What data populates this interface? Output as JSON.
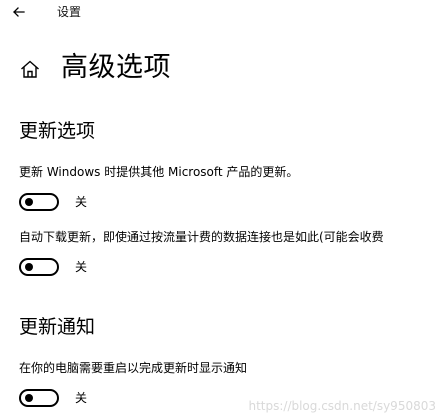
{
  "window": {
    "title": "设置"
  },
  "page": {
    "title": "高级选项"
  },
  "sections": [
    {
      "heading": "更新选项",
      "items": [
        {
          "label": "更新 Windows 时提供其他 Microsoft 产品的更新。",
          "state": "关",
          "on": false
        },
        {
          "label": "自动下载更新，即使通过按流量计费的数据连接也是如此(可能会收费",
          "state": "关",
          "on": false
        }
      ]
    },
    {
      "heading": "更新通知",
      "items": [
        {
          "label": "在你的电脑需要重启以完成更新时显示通知",
          "state": "关",
          "on": false
        }
      ]
    }
  ],
  "watermark": "https://blog.csdn.net/sy950803",
  "icons": {
    "back": "back-arrow-icon",
    "home": "home-icon"
  }
}
